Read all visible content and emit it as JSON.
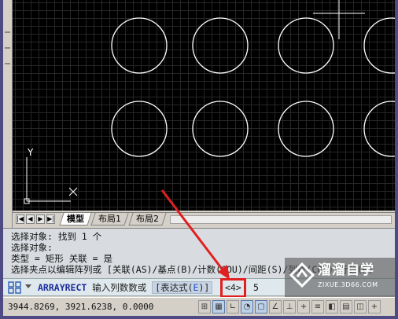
{
  "canvas": {
    "circle_color": "#ffffff",
    "background_color": "#000000",
    "ucs_y_label": "Y",
    "ucs_x_label": "X"
  },
  "layout_tabs": {
    "nav_buttons": [
      "|◀",
      "◀",
      "▶",
      "▶|"
    ],
    "tabs": [
      {
        "label": "模型",
        "active": true
      },
      {
        "label": "布局1",
        "active": false
      },
      {
        "label": "布局2",
        "active": false
      }
    ]
  },
  "command_history": {
    "lines": [
      "选择对象: 找到 1 个",
      "选择对象:",
      "类型 = 矩形  关联 = 是",
      "选择夹点以编辑阵列或 [关联(AS)/基点(B)/计数(COU)/间距(S)/列数(COL)/行数(R)"
    ]
  },
  "command_line": {
    "icon": "array-command-icon",
    "command": "ARRAYRECT",
    "prompt": "输入列数数或",
    "option_prefix": "[表达式(",
    "option_hotkey": "E",
    "option_suffix": ")]",
    "default_value": "<4>",
    "input_value": "5",
    "highlight_color": "#e02020"
  },
  "annotation": {
    "arrow_color": "#e02020"
  },
  "status_bar": {
    "coordinates": "3944.8269, 3921.6238, 0.0000",
    "buttons": [
      "snap-icon",
      "grid-icon",
      "ortho-icon",
      "polar-icon",
      "osnap-icon",
      "otrack-icon",
      "ducs-icon",
      "dyn-icon",
      "lineweight-icon",
      "transparency-icon",
      "qp-icon",
      "sc-icon",
      "model-icon"
    ]
  },
  "watermark": {
    "title": "溜溜自学",
    "subtitle": "ZIXUE.3D66.COM"
  }
}
